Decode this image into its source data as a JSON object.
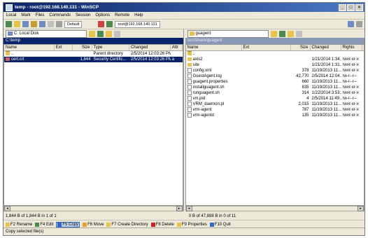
{
  "window": {
    "title": "temp - root@192.168.140.131 - WinSCP"
  },
  "menu": [
    "Local",
    "Mark",
    "Files",
    "Commands",
    "Session",
    "Options",
    "Remote",
    "Help"
  ],
  "toolbar": {
    "profile": "Default",
    "session": "root@192.168.140.131"
  },
  "left": {
    "drive": "C: Local Disk",
    "path": "C:\\temp",
    "columns": [
      "Name",
      "Ext",
      "Size",
      "Type",
      "Changed",
      "Attr"
    ],
    "rows": [
      {
        "name": "..",
        "size": "",
        "type": "Parent directory",
        "changed": "2/5/2014 12:03:26 PM",
        "attr": "",
        "icon": "up"
      },
      {
        "name": "cert.crt",
        "size": "1,844",
        "type": "Security Certific...",
        "changed": "2/5/2014 12:03:26 PM",
        "attr": "a",
        "icon": "cert",
        "selected": true
      }
    ],
    "status": "1,844 B of 1,844 B in 1 of 1"
  },
  "right": {
    "drive": "guagent",
    "path": "/usr/share/guagent",
    "columns": [
      "Name",
      "Ext",
      "Size",
      "Changed",
      "Rights"
    ],
    "rows": [
      {
        "name": "..",
        "size": "",
        "changed": "",
        "rights": "",
        "icon": "up"
      },
      {
        "name": "axis2",
        "size": "",
        "changed": "1/21/2014 1:34...",
        "rights": "rwxr-xr-x",
        "icon": "folder"
      },
      {
        "name": "site",
        "size": "",
        "changed": "1/21/2014 1:31...",
        "rights": "rwxr-xr-x",
        "icon": "folder"
      },
      {
        "name": "config.xml",
        "size": "378",
        "changed": "11/19/2013 11:...",
        "rights": "rwxr-xr-x",
        "icon": "file"
      },
      {
        "name": "GuestAgent.log",
        "size": "42,770",
        "changed": "2/5/2014 12:04...",
        "rights": "rw-r--r--",
        "icon": "file"
      },
      {
        "name": "guagent.properties",
        "size": "660",
        "changed": "11/19/2013 11:...",
        "rights": "rw-r--r--",
        "icon": "file"
      },
      {
        "name": "installguagent.sh",
        "size": "835",
        "changed": "11/19/2013 11:...",
        "rights": "rwxr-xr-x",
        "icon": "file"
      },
      {
        "name": "runguagent.sh",
        "size": "314",
        "changed": "1/22/2014 3:53...",
        "rights": "rwxr-xr-x",
        "icon": "file"
      },
      {
        "name": "vm.pid",
        "size": "4",
        "changed": "2/5/2014 11:49...",
        "rights": "rw-r--r--",
        "icon": "file"
      },
      {
        "name": "VRM_daemon.pl",
        "size": "2,015",
        "changed": "11/19/2013 11:...",
        "rights": "rwxr-xr-x",
        "icon": "file"
      },
      {
        "name": "vrm-agent",
        "size": "787",
        "changed": "11/19/2013 11:...",
        "rights": "rwxr-xr-x",
        "icon": "file"
      },
      {
        "name": "vrm-agentd",
        "size": "135",
        "changed": "11/19/2013 11:...",
        "rights": "rwxr-xr-x",
        "icon": "file"
      }
    ],
    "status": "0 B of 47,898 B in 0 of 11"
  },
  "fkeys": [
    {
      "label": "F2 Rename",
      "icon": "rename-icon",
      "color": "#e8c24a"
    },
    {
      "label": "F4 Edit",
      "icon": "edit-icon",
      "color": "#4a8a4a"
    },
    {
      "label": "F5 Copy",
      "icon": "copy-icon",
      "color": "#316ac5",
      "active": true
    },
    {
      "label": "F6 Move",
      "icon": "move-icon",
      "color": "#e8a030"
    },
    {
      "label": "F7 Create Directory",
      "icon": "new-folder-icon",
      "color": "#e8c24a"
    },
    {
      "label": "F8 Delete",
      "icon": "delete-icon",
      "color": "#d02020"
    },
    {
      "label": "F9 Properties",
      "icon": "properties-icon",
      "color": "#e8c24a"
    },
    {
      "label": "F10 Quit",
      "icon": "quit-icon",
      "color": "#316ac5"
    }
  ],
  "footer": "Copy selected file(s)"
}
